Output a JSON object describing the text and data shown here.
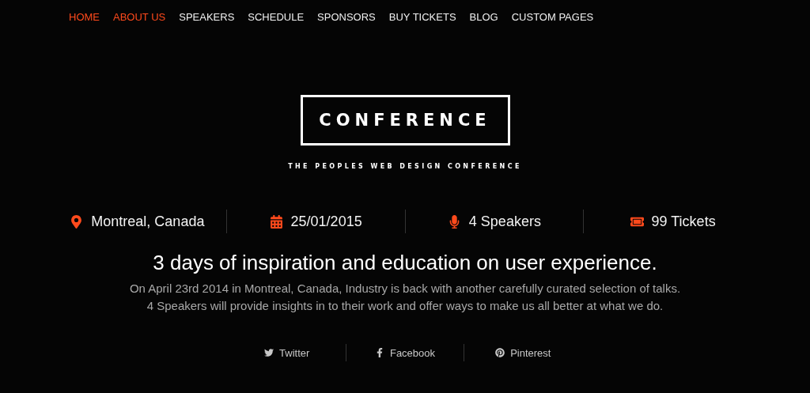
{
  "nav": [
    {
      "label": "HOME",
      "selected": true
    },
    {
      "label": "ABOUT US",
      "selected": true
    },
    {
      "label": "SPEAKERS",
      "selected": false
    },
    {
      "label": "SCHEDULE",
      "selected": false
    },
    {
      "label": "SPONSORS",
      "selected": false
    },
    {
      "label": "BUY TICKETS",
      "selected": false
    },
    {
      "label": "BLOG",
      "selected": false
    },
    {
      "label": "CUSTOM PAGES",
      "selected": false
    }
  ],
  "logo": {
    "title": "CONFERENCE",
    "tagline": "THE PEOPLES WEB DESIGN CONFERENCE"
  },
  "stats": [
    {
      "kind": "location",
      "text": "Montreal, Canada"
    },
    {
      "kind": "date",
      "text": "25/01/2015"
    },
    {
      "kind": "speakers",
      "text": "4 Speakers"
    },
    {
      "kind": "tickets",
      "text": "99 Tickets"
    }
  ],
  "headline": "3 days of inspiration and education on user experience.",
  "description": [
    "On April 23rd 2014 in Montreal, Canada, Industry is back with another carefully curated selection of talks.",
    "4 Speakers will provide insights in to their work and offer ways to make us all better at what we do."
  ],
  "social": [
    {
      "kind": "twitter",
      "label": "Twitter"
    },
    {
      "kind": "facebook",
      "label": "Facebook"
    },
    {
      "kind": "pinterest",
      "label": "Pinterest"
    }
  ]
}
